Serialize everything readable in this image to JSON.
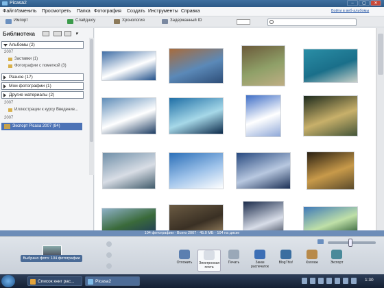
{
  "window": {
    "title": "Picasa2",
    "controls": [
      "–",
      "▢",
      "✕"
    ]
  },
  "menubar": {
    "items": [
      "Файл",
      "Изменить",
      "Просмотреть",
      "Папка",
      "Фотография",
      "Создать",
      "Инструменты",
      "Справка"
    ],
    "sign_in_link": "Войти в веб-альбомы"
  },
  "toolbar": {
    "import_label": "Импорт",
    "slideshow_label": "Слайдшоу",
    "timeline_label": "Хронология",
    "hidden_label": "Задержанный ID",
    "search_placeholder": ""
  },
  "sidebar": {
    "heading": "Библиотека",
    "groups": [
      {
        "label": "Альбомы (2)",
        "expanded": true
      },
      {
        "label": "Разное (17)",
        "expanded": false
      },
      {
        "label": "Мои фотографии (1)",
        "expanded": false
      },
      {
        "label": "Другие материалы (2)",
        "expanded": false
      }
    ],
    "years": [
      "2007",
      "2007",
      "2007"
    ],
    "album_items": [
      "Заставки (1)",
      "Фотографии с пометкой (3)"
    ],
    "folder_item": "Иллюстрации к курсу Введение...",
    "selected_item": "Экспорт Picasa 2007 (84)"
  },
  "statusbar": {
    "text": "104 фотографии · Всего 2007 · 45.0 МБ · 104 на диске"
  },
  "tray": {
    "hold_label": "Выбрано фото: 104 фотографии",
    "buttons": [
      "Отложить",
      "Электронная почта",
      "Печать",
      "Заказ распечаток",
      "BlogThis!",
      "Коллаж",
      "Экспорт"
    ]
  },
  "taskbar": {
    "tasks": [
      "Список книг рас...",
      "Picasa2"
    ],
    "clock": "1:30"
  },
  "photos": [
    {
      "colors": [
        "#3f6ea6",
        "#ffffff",
        "#1f4f8a"
      ]
    },
    {
      "colors": [
        "#a86b3c",
        "#5b89b8",
        "#2e4e78"
      ]
    },
    {
      "colors": [
        "#6b5a3a",
        "#8fa068",
        "#bfae84"
      ]
    },
    {
      "colors": [
        "#2a8ea6",
        "#1a6f8a",
        "#c9d0c8"
      ]
    },
    {
      "colors": [
        "#5f8db8",
        "#ffffff",
        "#1e3d63"
      ]
    },
    {
      "colors": [
        "#1f6fa6",
        "#a6d8e8",
        "#0c2a4a"
      ]
    },
    {
      "colors": [
        "#3f6ec6",
        "#ffffff",
        "#8fa8d8"
      ]
    },
    {
      "colors": [
        "#1c2a1c",
        "#c8b06a",
        "#445538"
      ]
    },
    {
      "colors": [
        "#6f8fa8",
        "#d8dde5",
        "#3f5a6a"
      ]
    },
    {
      "colors": [
        "#2b6fb8",
        "#9fc3ea",
        "#ffffff"
      ]
    },
    {
      "colors": [
        "#27497f",
        "#b8c8e0",
        "#1a2f55"
      ]
    },
    {
      "colors": [
        "#2a2012",
        "#c89a4a",
        "#5a4a2a"
      ]
    },
    {
      "colors": [
        "#8fb2c8",
        "#3a6a3a",
        "#1f3a5a"
      ]
    },
    {
      "colors": [
        "#6a5a42",
        "#3a3024",
        "#a8906a"
      ]
    },
    {
      "colors": [
        "#1a2a4a",
        "#d8dde8",
        "#0a1428"
      ]
    },
    {
      "colors": [
        "#3f7ab8",
        "#bfe0a8",
        "#1f4f2a"
      ]
    }
  ]
}
